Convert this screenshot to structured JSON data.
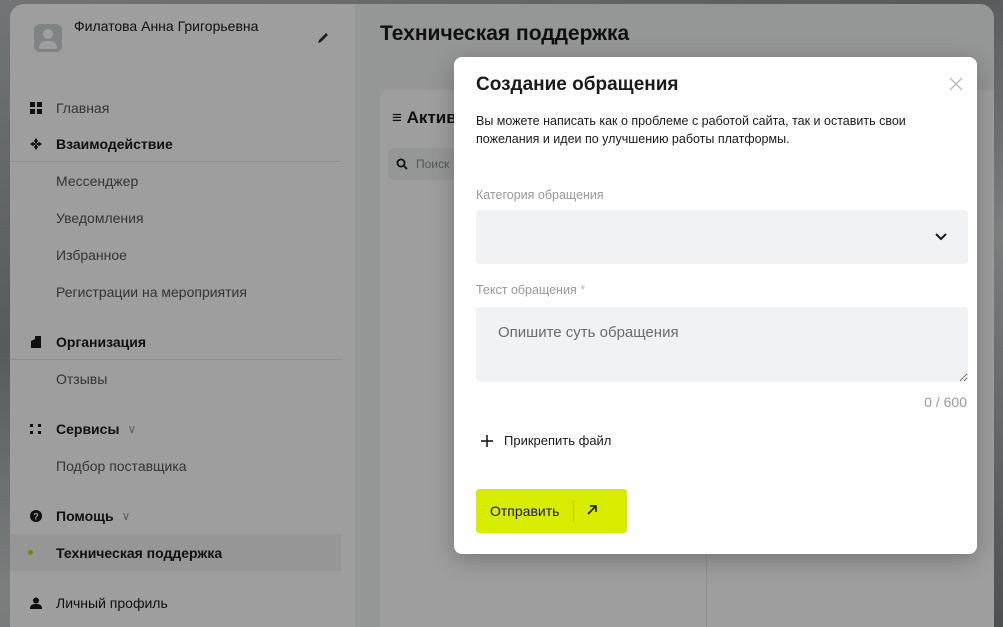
{
  "profile": {
    "name": "Филатова Анна Григорьевна"
  },
  "page": {
    "title": "Техническая поддержка"
  },
  "sidebar": {
    "home": "Главная",
    "interaction": {
      "label": "Взаимодействие",
      "items": [
        "Мессенджер",
        "Уведомления",
        "Избранное",
        "Регистрации на мероприятия"
      ]
    },
    "organization": {
      "label": "Организация",
      "items": [
        "Отзывы"
      ]
    },
    "services": {
      "label": "Сервисы",
      "items": [
        "Подбор поставщика"
      ]
    },
    "help": {
      "label": "Помощь",
      "items": [
        "Техническая поддержка"
      ]
    },
    "profile_link": "Личный профиль"
  },
  "panel": {
    "title": "Активные обращения",
    "search_placeholder": "Поиск"
  },
  "modal": {
    "title": "Создание обращения",
    "description": "Вы можете написать как о проблеме с работой сайта, так и оставить свои пожелания и идеи по улучшению работы платформы.",
    "category_label": "Категория обращения",
    "category_value": "",
    "text_label": "Текст обращения",
    "required_mark": "*",
    "text_placeholder": "Опишите суть обращения",
    "counter": "0 / 600",
    "attach_label": "Прикрепить файл",
    "submit_label": "Отправить"
  },
  "colors": {
    "accent": "#d8ec00",
    "active_dot": "#c4d600"
  }
}
